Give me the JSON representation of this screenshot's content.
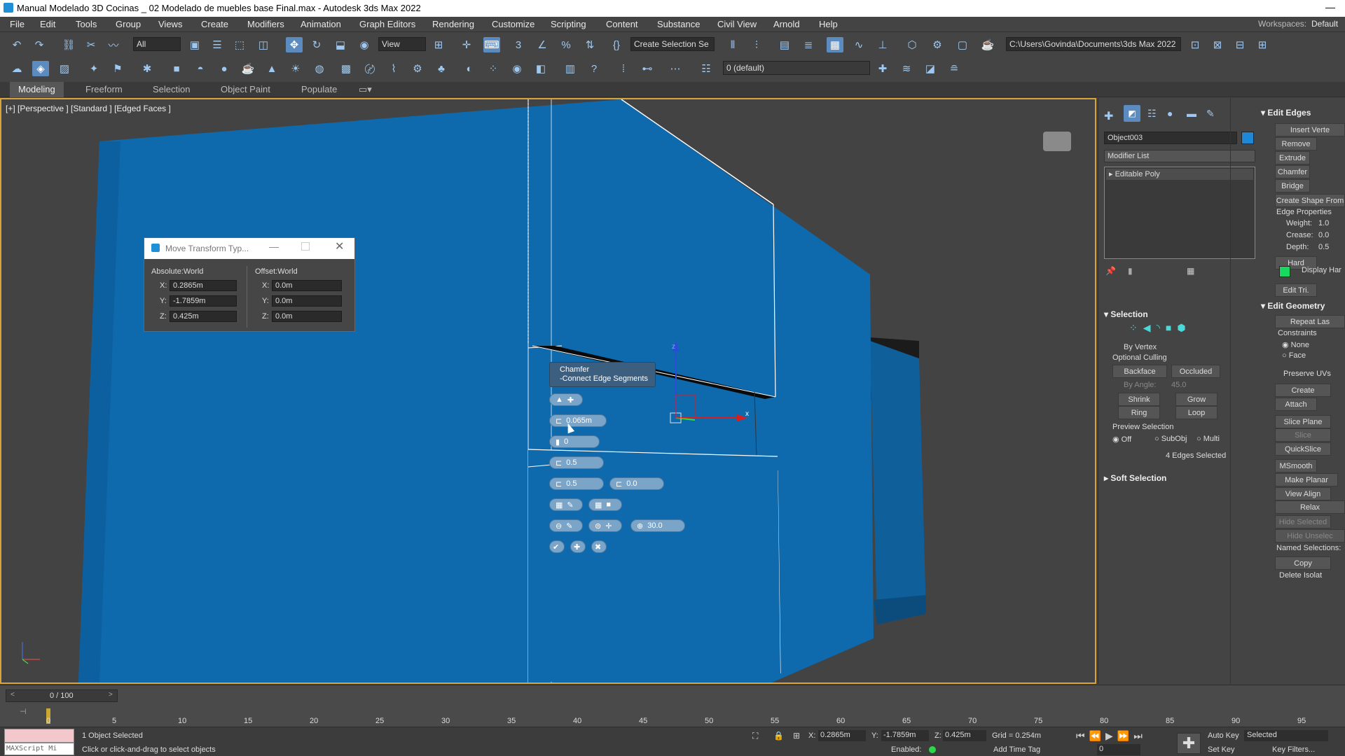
{
  "title": "Manual Modelado 3D Cocinas _ 02 Modelado de muebles base Final.max - Autodesk 3ds Max 2022",
  "menus": [
    "File",
    "Edit",
    "Tools",
    "Group",
    "Views",
    "Create",
    "Modifiers",
    "Animation",
    "Graph Editors",
    "Rendering",
    "Customize",
    "Scripting",
    "Content",
    "Substance",
    "Civil View",
    "Arnold",
    "Help"
  ],
  "workspaces_label": "Workspaces:",
  "workspaces_value": "Default",
  "toolbar": {
    "filter": "All",
    "view": "View",
    "selection_set": "Create Selection Se",
    "path": "C:\\Users\\Govinda\\Documents\\3ds Max 2022",
    "layer": "0 (default)"
  },
  "ribbon": {
    "tabs": [
      "Modeling",
      "Freeform",
      "Selection",
      "Object Paint",
      "Populate"
    ]
  },
  "viewport": {
    "label": "[+] [Perspective ] [Standard ] [Edged Faces ]"
  },
  "move_dialog": {
    "title": "Move Transform Typ...",
    "absolute_title": "Absolute:World",
    "offset_title": "Offset:World",
    "abs": {
      "x": "0.2865m",
      "y": "-1.7859m",
      "z": "0.425m"
    },
    "off": {
      "x": "0.0m",
      "y": "0.0m",
      "z": "0.0m"
    }
  },
  "caddy": {
    "title": "Chamfer",
    "subtitle": "-Connect Edge Segments",
    "amount": "0.065m",
    "segments": "0",
    "tension": "0.5",
    "v1": "0.5",
    "v2": "0.0",
    "angle": "30.0"
  },
  "cmd": {
    "object_name": "Object003",
    "object_color": "#1e88d8",
    "modifier_list": "Modifier List",
    "stack_item": "Editable Poly",
    "selection_title": "Selection",
    "by_vertex": "By Vertex",
    "optional_culling": "Optional Culling",
    "backface": "Backface",
    "occluded": "Occluded",
    "by_angle": "By Angle:",
    "by_angle_value": "45.0",
    "shrink": "Shrink",
    "grow": "Grow",
    "ring": "Ring",
    "loop": "Loop",
    "preview_selection": "Preview Selection",
    "preview_off": "Off",
    "preview_subobj": "SubObj",
    "preview_multi": "Multi",
    "edges_selected": "4 Edges Selected",
    "soft_selection": "Soft Selection",
    "edit_edges": "Edit Edges",
    "insert_vertex": "Insert Verte",
    "remove": "Remove",
    "extrude": "Extrude",
    "chamfer": "Chamfer",
    "bridge": "Bridge",
    "create_shape": "Create Shape From",
    "edge_properties": "Edge Properties",
    "weight_label": "Weight:",
    "weight": "1.0",
    "crease_label": "Crease:",
    "crease": "0.0",
    "depth_label": "Depth:",
    "depth": "0.5",
    "hard": "Hard",
    "display_hard": "Display Har",
    "edit_tri": "Edit Tri.",
    "edit_geometry": "Edit Geometry",
    "repeat_last": "Repeat Las",
    "constraints": "Constraints",
    "none": "None",
    "face": "Face",
    "preserve_uvs": "Preserve UVs",
    "create": "Create",
    "attach": "Attach",
    "slice_plane": "Slice Plane",
    "slice": "Slice",
    "quickslice": "QuickSlice",
    "msmooth": "MSmooth",
    "make_planar": "Make Planar",
    "view_align": "View Align",
    "relax": "Relax",
    "hide_selected": "Hide Selected",
    "hide_unselected": "Hide Unselec",
    "named_selections": "Named Selections:",
    "copy": "Copy",
    "delete_isolated": "Delete Isolat"
  },
  "timeline": {
    "frame": "0 / 100",
    "ticks": [
      "0",
      "5",
      "10",
      "15",
      "20",
      "25",
      "30",
      "35",
      "40",
      "45",
      "50",
      "55",
      "60",
      "65",
      "70",
      "75",
      "80",
      "85",
      "90",
      "95"
    ]
  },
  "status": {
    "maxscript": "MAXScript Mi",
    "selected": "1 Object Selected",
    "prompt": "Click or click-and-drag to select objects",
    "x": "0.2865m",
    "y": "-1.7859m",
    "z": "0.425m",
    "grid": "Grid = 0.254m",
    "enabled": "Enabled:",
    "add_time_tag": "Add Time Tag",
    "auto_key": "Auto Key",
    "selected_dd": "Selected",
    "set_key": "Set Key",
    "key_filters": "Key Filters...",
    "frame_field": "0"
  }
}
